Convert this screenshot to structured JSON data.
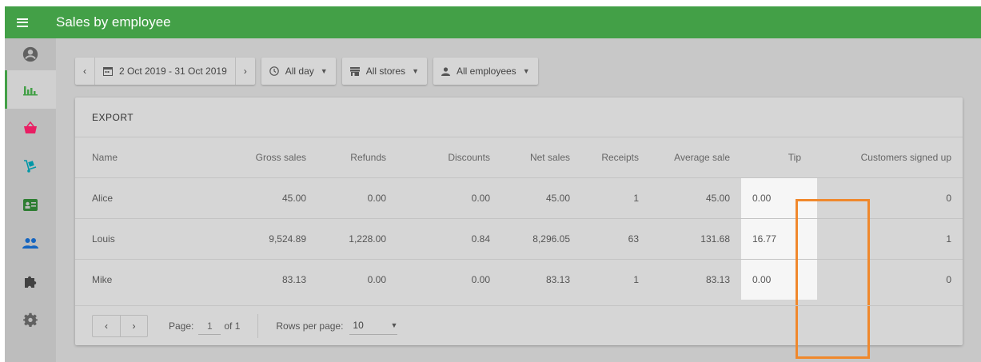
{
  "header": {
    "title": "Sales by employee"
  },
  "sidebar": {
    "items": [
      {
        "icon": "account-circle-icon",
        "color": "#616161"
      },
      {
        "icon": "bar-chart-icon",
        "color": "#43a047"
      },
      {
        "icon": "shopping-basket-icon",
        "color": "#e91e63"
      },
      {
        "icon": "dolly-icon",
        "color": "#0097a7"
      },
      {
        "icon": "id-card-icon",
        "color": "#2e7d32"
      },
      {
        "icon": "people-icon",
        "color": "#1565c0"
      },
      {
        "icon": "puzzle-icon",
        "color": "#424242"
      },
      {
        "icon": "gear-icon",
        "color": "#616161"
      }
    ]
  },
  "filters": {
    "prev": "‹",
    "date_range": "2 Oct 2019 - 31 Oct 2019",
    "next": "›",
    "time": "All day",
    "stores": "All stores",
    "employees": "All employees"
  },
  "card": {
    "export_label": "EXPORT",
    "columns": [
      "Name",
      "Gross sales",
      "Refunds",
      "Discounts",
      "Net sales",
      "Receipts",
      "Average sale",
      "Tip",
      "Customers signed up"
    ],
    "rows": [
      [
        "Alice",
        "45.00",
        "0.00",
        "0.00",
        "45.00",
        "1",
        "45.00",
        "0.00",
        "0"
      ],
      [
        "Louis",
        "9,524.89",
        "1,228.00",
        "0.84",
        "8,296.05",
        "63",
        "131.68",
        "16.77",
        "1"
      ],
      [
        "Mike",
        "83.13",
        "0.00",
        "0.00",
        "83.13",
        "1",
        "83.13",
        "0.00",
        "0"
      ]
    ],
    "highlight_color": "#f0882c"
  },
  "pagination": {
    "prev": "‹",
    "next": "›",
    "page_label": "Page:",
    "page_value": "1",
    "of_label": "of 1",
    "rows_label": "Rows per page:",
    "rows_value": "10"
  },
  "colors": {
    "accent": "#43a047"
  }
}
